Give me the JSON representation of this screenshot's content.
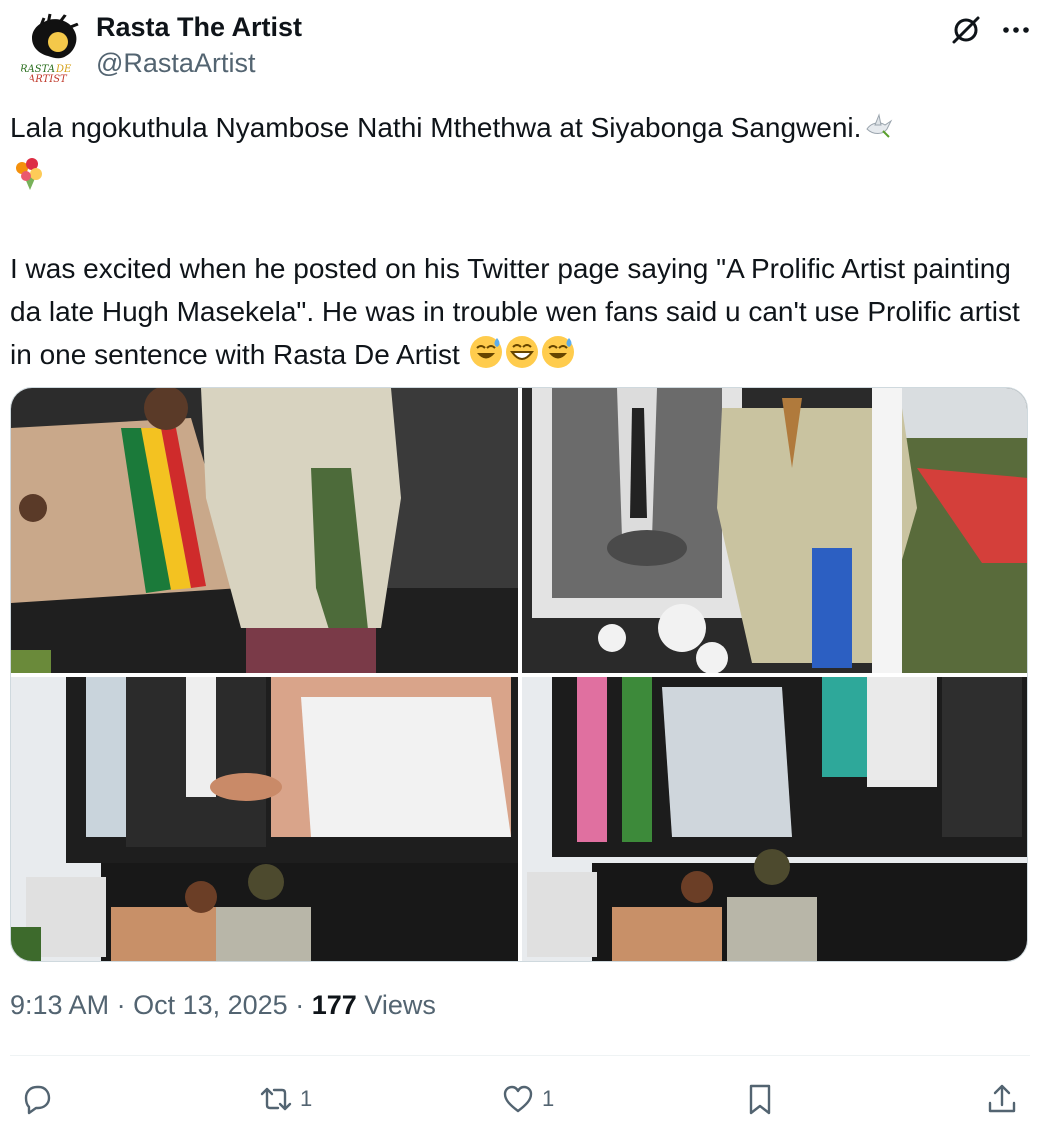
{
  "author": {
    "display_name": "Rasta The Artist",
    "handle": "@RastaArtist",
    "avatar_text": "RASTA DE ARTIST"
  },
  "tweet": {
    "line1": "Lala ngokuthula Nyambose Nathi Mthethwa at Siyabonga Sangweni.",
    "body": "I was excited when he posted on his Twitter page saying \"A Prolific Artist painting da late Hugh Masekela\". He was in trouble wen fans said u can't use Prolific artist in one sentence with Rasta De Artist",
    "emojis_line1": [
      "dove",
      "bouquet"
    ],
    "emojis_end": [
      "sweat-smile",
      "grin",
      "sweat-smile"
    ]
  },
  "meta": {
    "time": "9:13 AM",
    "date": "Oct 13, 2025",
    "views_count": "177",
    "views_label": "Views",
    "sep": "·"
  },
  "actions": {
    "reply_count": "",
    "retweet_count": "1",
    "like_count": "1"
  },
  "icons": {
    "grok": "grok-icon",
    "more": "more-icon",
    "reply": "reply-icon",
    "retweet": "retweet-icon",
    "like": "heart-icon",
    "bookmark": "bookmark-icon",
    "share": "share-icon"
  },
  "colors": {
    "text": "#0f1419",
    "secondary": "#536471",
    "border": "#cfd9de"
  }
}
